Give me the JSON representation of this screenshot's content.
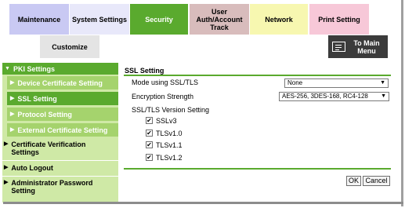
{
  "tabs": {
    "maintenance": "Maintenance",
    "system_settings": "System Settings",
    "security": "Security",
    "user_auth_1": "User",
    "user_auth_2": "Auth/Account",
    "user_auth_3": "Track",
    "network": "Network",
    "print_setting": "Print Setting",
    "customize": "Customize"
  },
  "main_menu": {
    "label_1": "To Main",
    "label_2": "Menu"
  },
  "sidebar": {
    "pki_settings": "PKI Settings",
    "device_certificate": "Device Certificate Setting",
    "ssl_setting": "SSL Setting",
    "protocol_setting": "Protocol Setting",
    "external_certificate": "External Certificate Setting",
    "cert_verification_1": "Certificate Verification",
    "cert_verification_2": "Settings",
    "auto_logout": "Auto Logout",
    "admin_password_1": "Administrator Password",
    "admin_password_2": "Setting"
  },
  "content": {
    "title": "SSL Setting",
    "mode_label": "Mode using SSL/TLS",
    "mode_value": "None",
    "strength_label": "Encryption Strength",
    "strength_value": "AES-256, 3DES-168, RC4-128",
    "version_label": "SSL/TLS Version Setting",
    "versions": [
      "SSLv3",
      "TLSv1.0",
      "TLSv1.1",
      "TLSv1.2"
    ],
    "checkmark": "✔",
    "ok": "OK",
    "cancel": "Cancel"
  },
  "colors": {
    "accent": "#5aaa2e",
    "nav_bg": "#cfe9a6",
    "sub_bg": "#a5d36d"
  }
}
